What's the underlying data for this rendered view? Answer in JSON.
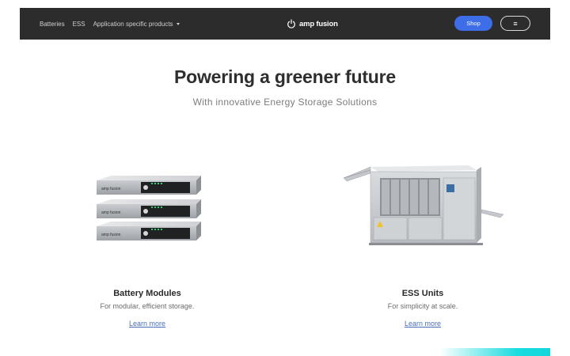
{
  "nav": {
    "links": [
      {
        "label": "Batteries"
      },
      {
        "label": "ESS"
      },
      {
        "label": "Application specific products"
      }
    ],
    "brand": "amp fusion",
    "shop_label": "Shop",
    "menu_glyph": "≡"
  },
  "hero": {
    "title": "Powering a greener future",
    "subtitle": "With innovative Energy Storage Solutions"
  },
  "products": [
    {
      "title": "Battery Modules",
      "description": "For modular, efficient storage.",
      "link": "Learn more",
      "module_label": "amp fusion"
    },
    {
      "title": "ESS Units",
      "description": "For simplicity at scale.",
      "link": "Learn more"
    }
  ],
  "icons": {
    "brand_icon": "power-icon",
    "menu_icon": "hamburger-icon",
    "dropdown_icon": "chevron-down-icon"
  },
  "colors": {
    "nav_background": "#2c2c2c",
    "shop_button": "#3d6ee8",
    "link": "#4a6fb8",
    "accent": "#19dcdf"
  }
}
